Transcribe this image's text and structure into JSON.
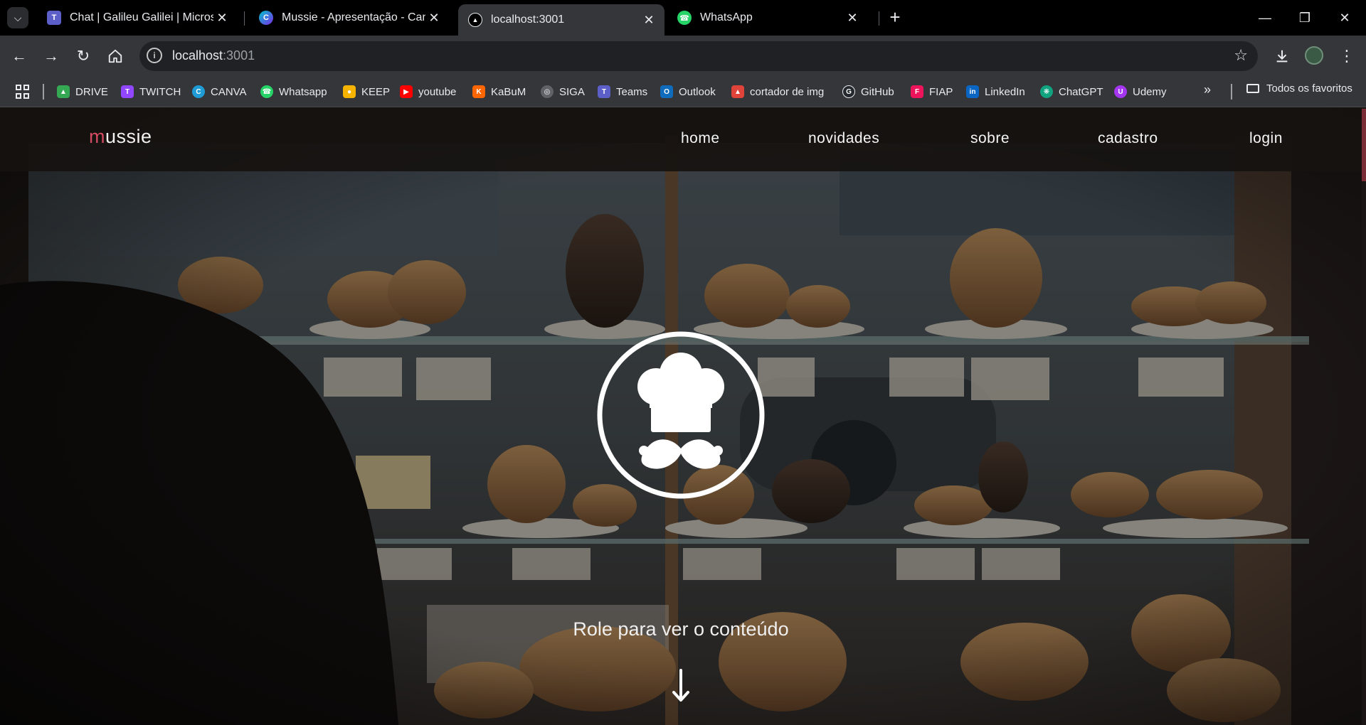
{
  "browser": {
    "tabs": [
      {
        "title": "Chat | Galileu Galilei | Microsoft",
        "icon": "teams-icon",
        "active": false
      },
      {
        "title": "Mussie - Apresentação - Canva",
        "icon": "canva-icon",
        "active": false
      },
      {
        "title": "localhost:3001",
        "icon": "site-icon",
        "active": true
      },
      {
        "title": "WhatsApp",
        "icon": "whatsapp-icon",
        "active": false
      }
    ],
    "address": {
      "host": "localhost",
      "port": ":3001"
    },
    "bookmarks": [
      {
        "label": "DRIVE",
        "icon": "drive-icon",
        "color": "#34a853"
      },
      {
        "label": "TWITCH",
        "icon": "twitch-icon",
        "color": "#9146ff"
      },
      {
        "label": "CANVA",
        "icon": "canva-icon",
        "color": "#1f9bd6"
      },
      {
        "label": "Whatsapp",
        "icon": "whatsapp-icon",
        "color": "#25d366"
      },
      {
        "label": "KEEP",
        "icon": "keep-icon",
        "color": "#f6b400"
      },
      {
        "label": "youtube",
        "icon": "youtube-icon",
        "color": "#ff0000"
      },
      {
        "label": "KaBuM",
        "icon": "kabum-icon",
        "color": "#ff6500"
      },
      {
        "label": "SIGA",
        "icon": "globe-icon",
        "color": "#5f6368"
      },
      {
        "label": "Teams",
        "icon": "teams-icon",
        "color": "#5b5fc7"
      },
      {
        "label": "Outlook",
        "icon": "outlook-icon",
        "color": "#0f6cbd"
      },
      {
        "label": "cortador de img",
        "icon": "cortador-icon",
        "color": "#e0433a"
      },
      {
        "label": "GitHub",
        "icon": "github-icon",
        "color": "#24292f"
      },
      {
        "label": "FIAP",
        "icon": "fiap-icon",
        "color": "#ed145b"
      },
      {
        "label": "LinkedIn",
        "icon": "linkedin-icon",
        "color": "#0a66c2"
      },
      {
        "label": "ChatGPT",
        "icon": "chatgpt-icon",
        "color": "#10a37f"
      },
      {
        "label": "Udemy",
        "icon": "udemy-icon",
        "color": "#a435f0"
      }
    ],
    "all_bookmarks": "Todos os favoritos"
  },
  "site": {
    "logo_first": "m",
    "logo_rest": "ussie",
    "nav": [
      "home",
      "novidades",
      "sobre",
      "cadastro",
      "login"
    ],
    "scroll_hint": "Role para ver o conteúdo",
    "accent": "#d34b62"
  }
}
